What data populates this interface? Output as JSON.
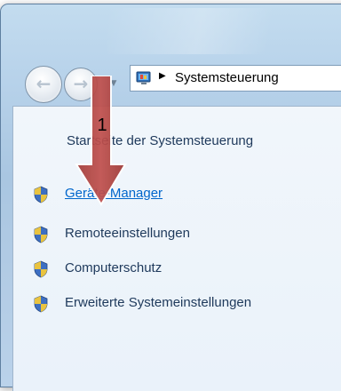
{
  "breadcrumb": {
    "current": "Systemsteuerung"
  },
  "tasks_pane": {
    "home_link": "Startseite der Systemsteuerung",
    "items": [
      {
        "label": "Geräte-Manager",
        "icon": "uac-shield-icon",
        "active": true
      },
      {
        "label": "Remoteeinstellungen",
        "icon": "uac-shield-icon"
      },
      {
        "label": "Computerschutz",
        "icon": "uac-shield-icon"
      },
      {
        "label": "Erweiterte Systemeinstellungen",
        "icon": "uac-shield-icon"
      }
    ]
  },
  "annotation": {
    "step_number": "1",
    "arrow_color": "#c0504d"
  },
  "colors": {
    "link_active": "#0066cc",
    "link_text": "#1e395b",
    "pane_background": "#eaf2fa"
  }
}
